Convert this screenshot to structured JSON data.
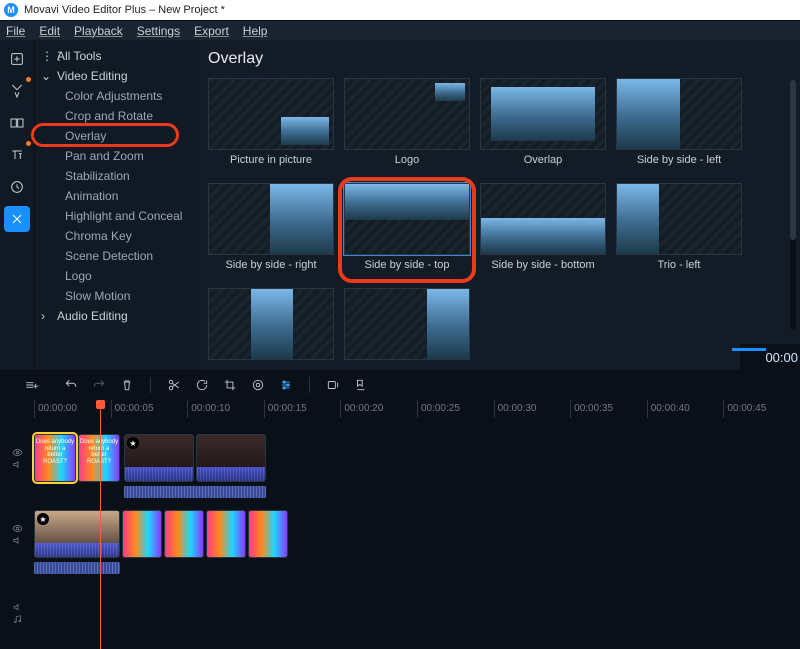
{
  "window": {
    "title": "Movavi Video Editor Plus – New Project *"
  },
  "menubar": [
    "File",
    "Edit",
    "Playback",
    "Settings",
    "Export",
    "Help"
  ],
  "rail": [
    {
      "name": "add-media-icon"
    },
    {
      "name": "filters-icon",
      "dot": true
    },
    {
      "name": "transitions-icon"
    },
    {
      "name": "titles-icon",
      "dot": true
    },
    {
      "name": "stickers-icon"
    },
    {
      "name": "more-tools-icon",
      "active": true
    }
  ],
  "sidebar": {
    "all_tools": "All Tools",
    "video_editing": "Video Editing",
    "items": [
      "Color Adjustments",
      "Crop and Rotate",
      "Overlay",
      "Pan and Zoom",
      "Stabilization",
      "Animation",
      "Highlight and Conceal",
      "Chroma Key",
      "Scene Detection",
      "Logo",
      "Slow Motion"
    ],
    "audio_editing": "Audio Editing",
    "selected_index": 2
  },
  "content": {
    "title": "Overlay",
    "cards": [
      "Picture in picture",
      "Logo",
      "Overlap",
      "Side by side - left",
      "Side by side - right",
      "Side by side - top",
      "Side by side - bottom",
      "Trio - left"
    ],
    "highlighted_index": 5,
    "timecode": "00:00"
  },
  "toolbar": {
    "undo": "undo",
    "redo": "redo",
    "delete": "delete",
    "cut": "cut",
    "rotate": "rotate",
    "crop": "crop",
    "color": "color",
    "adjust": "adjust",
    "record": "record",
    "marker": "marker"
  },
  "ruler": [
    "00:00:00",
    "00:00:05",
    "00:00:10",
    "00:00:15",
    "00:00:20",
    "00:00:25",
    "00:00:30",
    "00:00:35",
    "00:00:40",
    "00:00:45"
  ],
  "clip_text": {
    "a": "Does anybody return a",
    "b": "better ROAST?"
  }
}
